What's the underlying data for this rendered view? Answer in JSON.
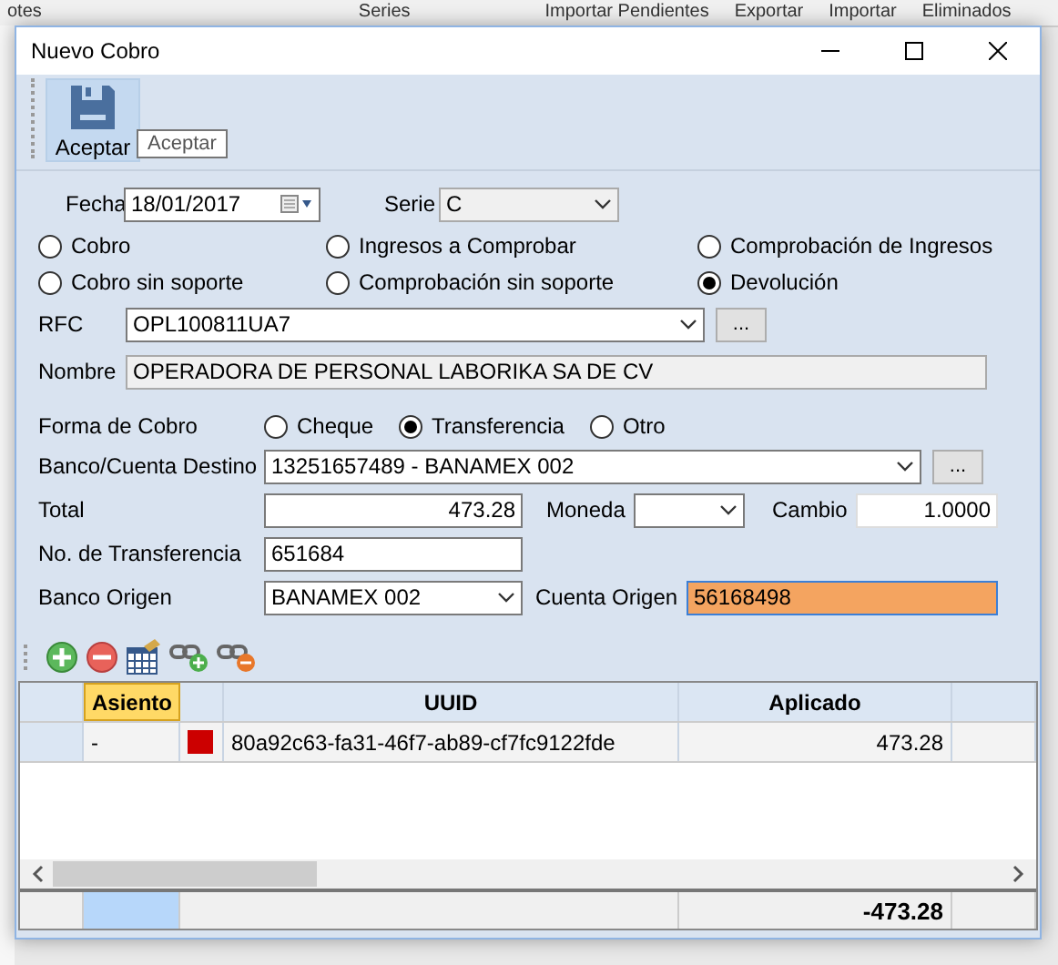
{
  "background_app": {
    "toolbar_items": [
      "otes",
      "Series",
      "Importar Pendientes",
      "Exportar",
      "Importar",
      "Eliminados"
    ]
  },
  "window": {
    "title": "Nuevo Cobro"
  },
  "toolbar": {
    "save_label": "Aceptar",
    "tooltip": "Aceptar"
  },
  "fecha": {
    "label": "Fecha",
    "value": "18/01/2017"
  },
  "serie": {
    "label": "Serie",
    "value": "C"
  },
  "tipo": [
    {
      "label": "Cobro",
      "selected": false
    },
    {
      "label": "Ingresos a Comprobar",
      "selected": false
    },
    {
      "label": "Comprobación de Ingresos",
      "selected": false
    },
    {
      "label": "Cobro sin soporte",
      "selected": false
    },
    {
      "label": "Comprobación sin soporte",
      "selected": false
    },
    {
      "label": "Devolución",
      "selected": true
    }
  ],
  "rfc": {
    "label": "RFC",
    "value": "OPL100811UA7",
    "button": "..."
  },
  "nombre": {
    "label": "Nombre",
    "value": "OPERADORA DE PERSONAL LABORIKA SA DE CV"
  },
  "forma_de_cobro": {
    "label": "Forma de Cobro",
    "options": [
      {
        "label": "Cheque",
        "selected": false
      },
      {
        "label": "Transferencia",
        "selected": true
      },
      {
        "label": "Otro",
        "selected": false
      }
    ]
  },
  "banco_destino": {
    "label": "Banco/Cuenta Destino",
    "value": "13251657489 - BANAMEX  002",
    "button": "..."
  },
  "total": {
    "label": "Total",
    "value": "473.28"
  },
  "moneda": {
    "label": "Moneda"
  },
  "cambio": {
    "label": "Cambio",
    "value": "1.0000"
  },
  "no_transferencia": {
    "label": "No. de Transferencia",
    "value": "651684"
  },
  "banco_origen": {
    "label": "Banco Origen",
    "value": "BANAMEX  002"
  },
  "cuenta_origen": {
    "label": "Cuenta Origen",
    "value": "56168498"
  },
  "table": {
    "columns": [
      {
        "label": "Asiento",
        "selected": true
      },
      {
        "label": "UUID",
        "selected": false
      },
      {
        "label": "Aplicado",
        "selected": false
      }
    ],
    "rows": [
      {
        "asiento": "-",
        "color": "#cc0000",
        "uuid": "80a92c63-fa31-46f7-ab89-cf7fc9122fde",
        "aplicado": "473.28"
      }
    ],
    "footer_total": "-473.28"
  }
}
